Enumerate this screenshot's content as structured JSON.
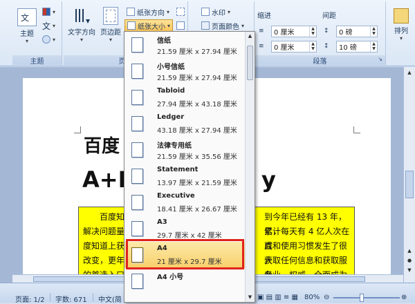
{
  "left_strip": {
    "char": "※"
  },
  "ribbon": {
    "theme_group": {
      "label": "主题",
      "theme_button": "主题",
      "colors_icon": "theme-colors-icon",
      "fonts_glyph": "文",
      "effects_icon": "theme-effects-icon"
    },
    "page_setup_group": {
      "label": "页面",
      "text_direction": "文字方向",
      "margins": "页边距",
      "orientation": "纸张方向",
      "size": "纸张大小",
      "breaks_icon": "breaks-icon",
      "line_numbers_icon": "line-numbers-icon",
      "hyphenation_icon": "hyphenation-icon"
    },
    "background_group": {
      "watermark": "水印",
      "page_color": "页面颜色"
    },
    "paragraph_group": {
      "label": "段落",
      "indent_header": "缩进",
      "spacing_header": "间距",
      "indent_left": "0 厘米",
      "indent_right": "0 厘米",
      "spacing_before": "0 磅",
      "spacing_after": "10 磅"
    },
    "arrange_group": {
      "arrange": "排列"
    }
  },
  "document": {
    "title_line1": "百度",
    "title_line2": "A+B",
    "title_line2_tail": "y",
    "yellow_lines_left": [
      "百度知",
      "解决问题量",
      "度知道上获",
      "改变，更年",
      "的首选入口"
    ],
    "yellow_lines_right": [
      "到今年已经有 13 年，累计",
      "亿，每天有 4 亿人次在百",
      "成和使用习惯发生了很大",
      "获取任何信息和获取服务",
      "专业、权威、全面成为他"
    ]
  },
  "paper_size_menu": {
    "items": [
      {
        "name": "信纸",
        "size": "21.59 厘米 x 27.94 厘米"
      },
      {
        "name": "小号信纸",
        "size": "21.59 厘米 x 27.94 厘米"
      },
      {
        "name": "Tabloid",
        "size": "27.94 厘米 x 43.18 厘米"
      },
      {
        "name": "Ledger",
        "size": "43.18 厘米 x 27.94 厘米"
      },
      {
        "name": "法律专用纸",
        "size": "21.59 厘米 x 35.56 厘米"
      },
      {
        "name": "Statement",
        "size": "13.97 厘米 x 21.59 厘米"
      },
      {
        "name": "Executive",
        "size": "18.41 厘米 x 26.67 厘米"
      },
      {
        "name": "A3",
        "size": "29.7 厘米 x 42 厘米"
      },
      {
        "name": "A4",
        "size": "21 厘米 x 29.7 厘米"
      },
      {
        "name": "A4 小号",
        "size": ""
      }
    ],
    "selected": "A4",
    "highlight_color": "#e0221c"
  },
  "status_bar": {
    "page": "页面: 1/2",
    "words": "字数: 671",
    "language": "中文(简",
    "zoom": "80%"
  }
}
